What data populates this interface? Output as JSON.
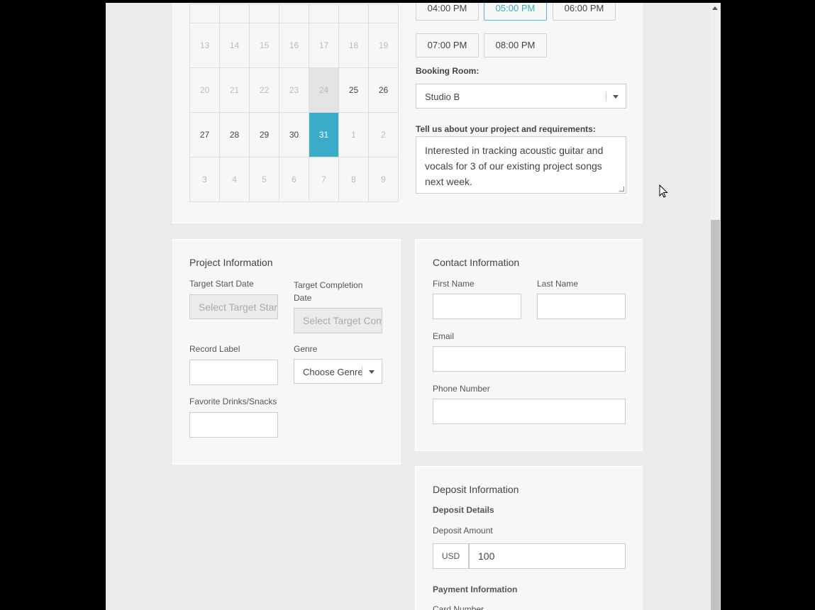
{
  "calendar": {
    "top_row": [
      "",
      "",
      "",
      "",
      "",
      "",
      ""
    ],
    "weeks": [
      [
        {
          "d": "13",
          "s": "off"
        },
        {
          "d": "14",
          "s": "off"
        },
        {
          "d": "15",
          "s": "off"
        },
        {
          "d": "16",
          "s": "off"
        },
        {
          "d": "17",
          "s": "off"
        },
        {
          "d": "18",
          "s": "off"
        },
        {
          "d": "19",
          "s": "off"
        }
      ],
      [
        {
          "d": "20",
          "s": "off"
        },
        {
          "d": "21",
          "s": "off"
        },
        {
          "d": "22",
          "s": "off"
        },
        {
          "d": "23",
          "s": "off"
        },
        {
          "d": "24",
          "s": "past"
        },
        {
          "d": "25",
          "s": "cur"
        },
        {
          "d": "26",
          "s": "cur"
        }
      ],
      [
        {
          "d": "27",
          "s": "cur"
        },
        {
          "d": "28",
          "s": "cur"
        },
        {
          "d": "29",
          "s": "cur"
        },
        {
          "d": "30",
          "s": "cur"
        },
        {
          "d": "31",
          "s": "sel"
        },
        {
          "d": "1",
          "s": "off"
        },
        {
          "d": "2",
          "s": "off"
        }
      ],
      [
        {
          "d": "3",
          "s": "off"
        },
        {
          "d": "4",
          "s": "off"
        },
        {
          "d": "5",
          "s": "off"
        },
        {
          "d": "6",
          "s": "off"
        },
        {
          "d": "7",
          "s": "off"
        },
        {
          "d": "8",
          "s": "off"
        },
        {
          "d": "9",
          "s": "off"
        }
      ]
    ]
  },
  "time_slots": [
    "04:00 PM",
    "05:00 PM",
    "06:00 PM",
    "07:00 PM",
    "08:00 PM"
  ],
  "selected_time": "05:00 PM",
  "booking": {
    "room_label": "Booking Room:",
    "room_value": "Studio B",
    "project_label": "Tell us about your project and requirements:",
    "project_text": "Interested in tracking acoustic guitar and vocals for 3 of our existing project songs next week."
  },
  "project_info": {
    "title": "Project Information",
    "start_label": "Target Start Date",
    "start_placeholder": "Select Target Start Date",
    "completion_label": "Target Completion Date",
    "completion_placeholder": "Select Target Completion Date",
    "label_label": "Record Label",
    "genre_label": "Genre",
    "genre_placeholder": "Choose Genre",
    "drinks_label": "Favorite Drinks/Snacks"
  },
  "contact": {
    "title": "Contact Information",
    "first_label": "First Name",
    "last_label": "Last Name",
    "email_label": "Email",
    "phone_label": "Phone Number"
  },
  "deposit": {
    "title": "Deposit Information",
    "details_label": "Deposit Details",
    "amount_label": "Deposit Amount",
    "currency": "USD",
    "amount": "100",
    "payment_label": "Payment Information",
    "card_label": "Card Number"
  },
  "colors": {
    "accent": "#3aacc7",
    "past": "#e4e4e4",
    "panel": "#f7f7f7"
  }
}
